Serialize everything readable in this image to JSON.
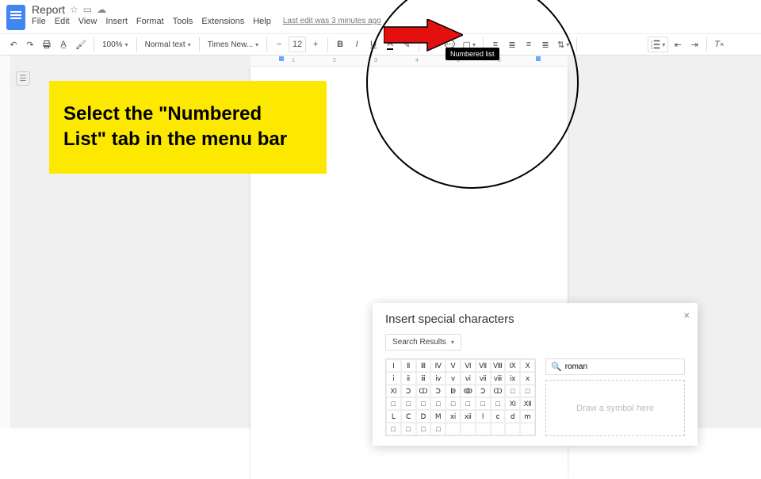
{
  "doc": {
    "title": "Report"
  },
  "menu": {
    "file": "File",
    "edit": "Edit",
    "view": "View",
    "insert": "Insert",
    "format": "Format",
    "tools": "Tools",
    "extensions": "Extensions",
    "help": "Help",
    "last_edit": "Last edit was 3 minutes ago"
  },
  "toolbar": {
    "zoom": "100%",
    "style": "Normal text",
    "font": "Times New...",
    "size": "12",
    "bold": "B",
    "italic": "I",
    "underline": "U",
    "strike": "A"
  },
  "tooltip": {
    "numbered_list": "Numbered list"
  },
  "ruler": {
    "marks": [
      "1",
      "2",
      "3",
      "4",
      "5",
      "6"
    ]
  },
  "callout": {
    "line1": "Select the \"Numbered",
    "line2": "List\" tab in the menu bar"
  },
  "special": {
    "title": "Insert special characters",
    "dropdown": "Search Results",
    "search_value": "roman",
    "draw_placeholder": "Draw a symbol here",
    "grid": [
      [
        "Ⅰ",
        "Ⅱ",
        "Ⅲ",
        "Ⅳ",
        "Ⅴ",
        "Ⅵ",
        "Ⅶ",
        "Ⅷ",
        "Ⅸ",
        "Ⅹ"
      ],
      [
        "ⅰ",
        "ⅱ",
        "ⅲ",
        "ⅳ",
        "ⅴ",
        "ⅵ",
        "ⅶ",
        "ⅷ",
        "ⅸ",
        "ⅹ"
      ],
      [
        "Ⅺ",
        "Ↄ",
        "ↀ",
        "Ↄ",
        "ↁ",
        "ↂ",
        "Ↄ",
        "ↀ",
        "□",
        "□"
      ],
      [
        "□",
        "□",
        "□",
        "□",
        "□",
        "□",
        "□",
        "□",
        "Ⅺ",
        "Ⅻ"
      ],
      [
        "Ⅼ",
        "Ⅽ",
        "Ⅾ",
        "Ⅿ",
        "ⅺ",
        "ⅻ",
        "ⅼ",
        "ⅽ",
        "ⅾ",
        "ⅿ"
      ],
      [
        "□",
        "□",
        "□",
        "□",
        "",
        "",
        "",
        "",
        "",
        ""
      ]
    ]
  }
}
